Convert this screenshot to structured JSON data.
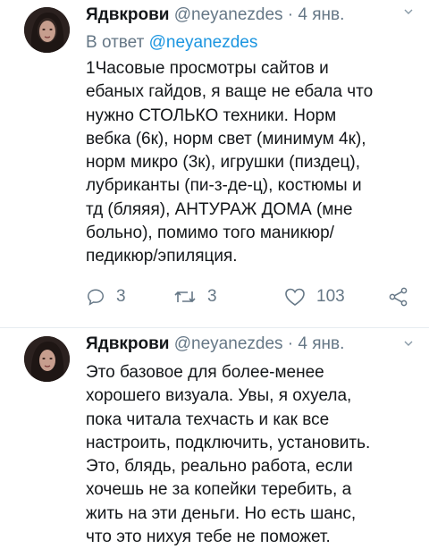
{
  "tweets": [
    {
      "author_name": "Ядвкрови",
      "handle": "@neyanezdes",
      "separator": " · ",
      "date": "4 янв.",
      "reply_prefix": "В ответ ",
      "reply_to": "@neyanezdes",
      "body_lines": [
        "1Часовые просмотры сайтов и",
        "ебаных гайдов, я ваще не ебала что",
        "нужно СТОЛЬКО техники. Норм",
        "вебка (6к), норм свет (минимум 4к),",
        "норм микро (3к), игрушки (пиздец),",
        "лубриканты (пи-з-де-ц), костюмы и",
        "тд (бляяя), АНТУРАЖ ДОМА (мне",
        "больно), помимо того маникюр/",
        "педикюр/эпиляция."
      ],
      "replies": "3",
      "retweets": "3",
      "likes": "103"
    },
    {
      "author_name": "Ядвкрови",
      "handle": "@neyanezdes",
      "separator": " · ",
      "date": "4 янв.",
      "body_lines": [
        "Это базовое для более-менее",
        "хорошего визуала. Увы, я охуела,",
        "пока читала техчасть и как все",
        "настроить, подключить, установить.",
        "Это, блядь, реально работа, если",
        "хочешь не за копейки теребить, а",
        "жить на эти деньги. Но есть шанс,",
        "что это нихуя тебе не поможет."
      ]
    }
  ],
  "colors": {
    "text": "#14171a",
    "secondary": "#657786",
    "link": "#1b95e0",
    "divider": "#e6ecf0"
  },
  "icons": [
    "reply-icon",
    "retweet-icon",
    "like-icon",
    "share-icon",
    "chevron-down-icon"
  ]
}
